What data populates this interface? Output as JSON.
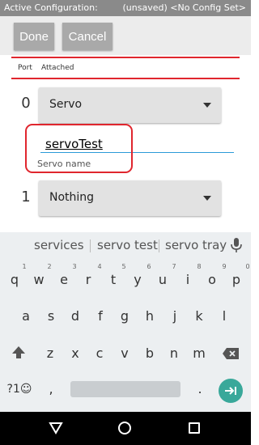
{
  "config_bar": {
    "label": "Active Configuration:",
    "status": "(unsaved) <No Config Set>"
  },
  "toolbar": {
    "done_label": "Done",
    "cancel_label": "Cancel"
  },
  "table_header": {
    "port": "Port",
    "attached": "Attached"
  },
  "ports": [
    {
      "number": "0",
      "attached": "Servo",
      "device_name": "servoTest",
      "name_label": "Servo name"
    },
    {
      "number": "1",
      "attached": "Nothing"
    }
  ],
  "keyboard": {
    "suggestions": [
      "services",
      "servo test",
      "servo tray"
    ],
    "row1": [
      "q",
      "w",
      "e",
      "r",
      "t",
      "y",
      "u",
      "i",
      "o",
      "p"
    ],
    "row1_hints": [
      "1",
      "2",
      "3",
      "4",
      "5",
      "6",
      "7",
      "8",
      "9",
      "0"
    ],
    "row2": [
      "a",
      "s",
      "d",
      "f",
      "g",
      "h",
      "j",
      "k",
      "l"
    ],
    "row3": [
      "z",
      "x",
      "c",
      "v",
      "b",
      "n",
      "m"
    ],
    "symbols_label": "?1☺",
    "comma": ",",
    "period": ".",
    "icons": {
      "mic": "microphone-icon",
      "shift": "shift-icon",
      "backspace": "backspace-icon",
      "enter": "enter-icon"
    }
  },
  "colors": {
    "accent_red": "#e0262e",
    "focus_blue": "#2b9bd8",
    "enter_teal": "#39a89a"
  }
}
